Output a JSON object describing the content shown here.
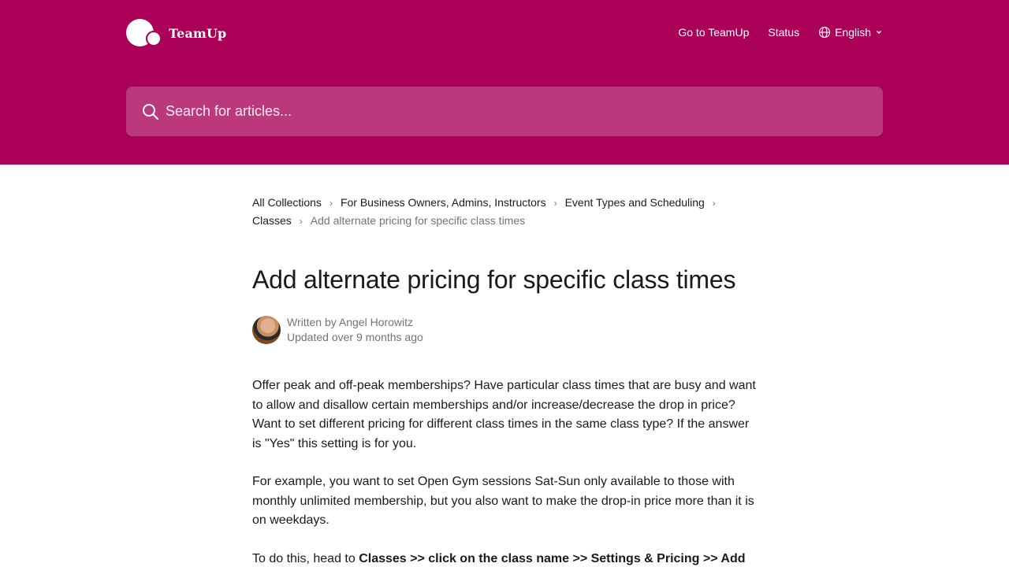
{
  "brand": {
    "name": "TeamUp",
    "color": "#aa0058"
  },
  "nav": {
    "go_label": "Go to TeamUp",
    "status_label": "Status",
    "language_label": "English"
  },
  "search": {
    "placeholder": "Search for articles..."
  },
  "breadcrumb": {
    "items": [
      "All Collections",
      "For Business Owners, Admins, Instructors",
      "Event Types and Scheduling",
      "Classes"
    ],
    "current": "Add alternate pricing for specific class times"
  },
  "article": {
    "title": "Add alternate pricing for specific class times",
    "author_line": "Written by Angel Horowitz",
    "updated": "Updated over 9 months ago",
    "paragraphs": [
      "Offer peak and off-peak memberships? Have particular class times that are busy and want to allow and disallow certain memberships and/or increase/decrease the drop in price? Want to set different pricing for different class times in the same class type? If the answer is \"Yes\" this setting is for you.",
      "For example, you want to set Open Gym sessions Sat-Sun only available to those with monthly unlimited membership, but you also want to make the drop-in price more than it is on weekdays."
    ],
    "p3_prefix": "To do this, head to ",
    "p3_bold": "Classes >> click on the class name >> Settings & Pricing >> Add"
  }
}
